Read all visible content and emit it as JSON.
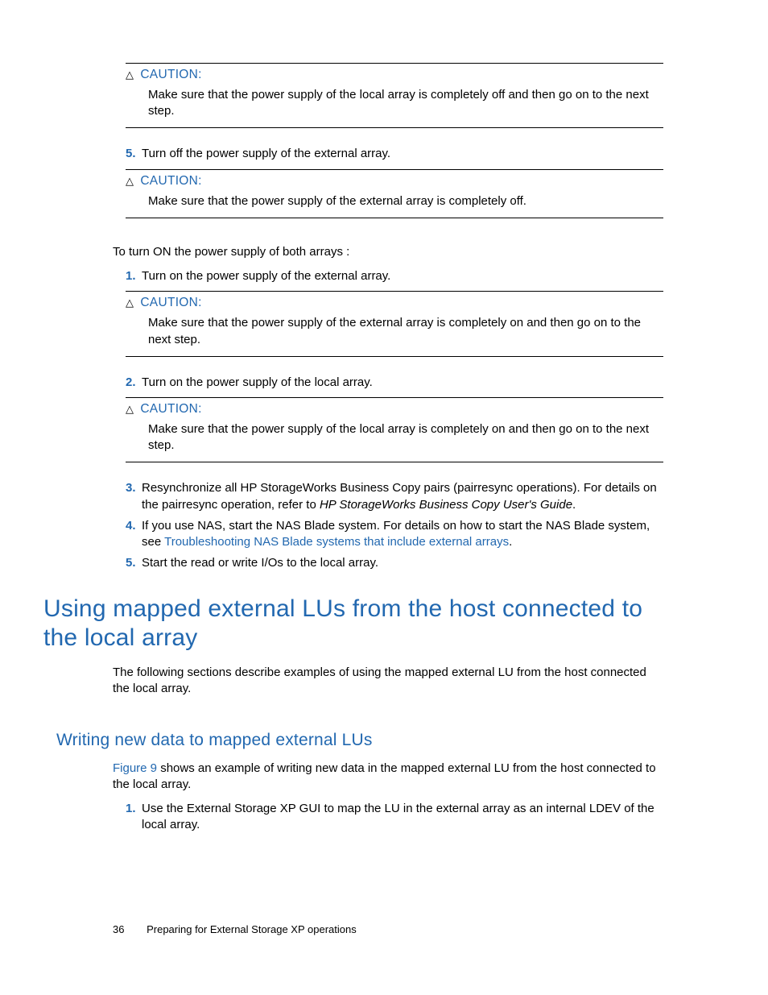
{
  "caution_label": "CAUTION:",
  "caution1_body": "Make sure that the power supply of the local array is completely off and then go on to the next step.",
  "off_step5_num": "5.",
  "off_step5_txt": "Turn off the power supply of the external array.",
  "caution2_body": "Make sure that the power supply of the external array is completely off.",
  "turn_on_intro": "To turn ON the power supply of both arrays :",
  "on_step1_num": "1.",
  "on_step1_txt": "Turn on the power supply of the external array.",
  "caution3_body": "Make sure that the power supply of the external array is completely on and then go on to the next step.",
  "on_step2_num": "2.",
  "on_step2_txt": "Turn on the power supply of the local array.",
  "caution4_body": "Make sure that the power supply of the local array is completely on and then go on to the next step.",
  "on_step3_num": "3.",
  "on_step3_txt_a": "Resynchronize all HP StorageWorks Business Copy pairs (pairresync operations). For details on the pairresync operation, refer to ",
  "on_step3_italic": "HP StorageWorks Business Copy User's Guide",
  "on_step3_txt_b": ".",
  "on_step4_num": "4.",
  "on_step4_txt_a": "If you use NAS, start the NAS Blade system. For details on how to start the NAS Blade system, see ",
  "on_step4_link": "Troubleshooting NAS Blade systems that include external arrays",
  "on_step4_txt_b": ".",
  "on_step5_num": "5.",
  "on_step5_txt": "Start the read or write I/Os to the local array.",
  "h1": "Using mapped external LUs from the host connected to the local array",
  "h1_intro": "The following sections describe examples of using the mapped external LU from the host connected the local array.",
  "h2": "Writing new data to mapped external LUs",
  "h2_p_link": "Figure 9",
  "h2_p_rest": " shows an example of writing new data in the mapped external LU from the host connected to the local array.",
  "h2_step1_num": "1.",
  "h2_step1_txt": "Use the External Storage XP GUI to map the LU in the external array as an internal LDEV of the local array.",
  "footer_page": "36",
  "footer_title": "Preparing for External Storage XP operations"
}
